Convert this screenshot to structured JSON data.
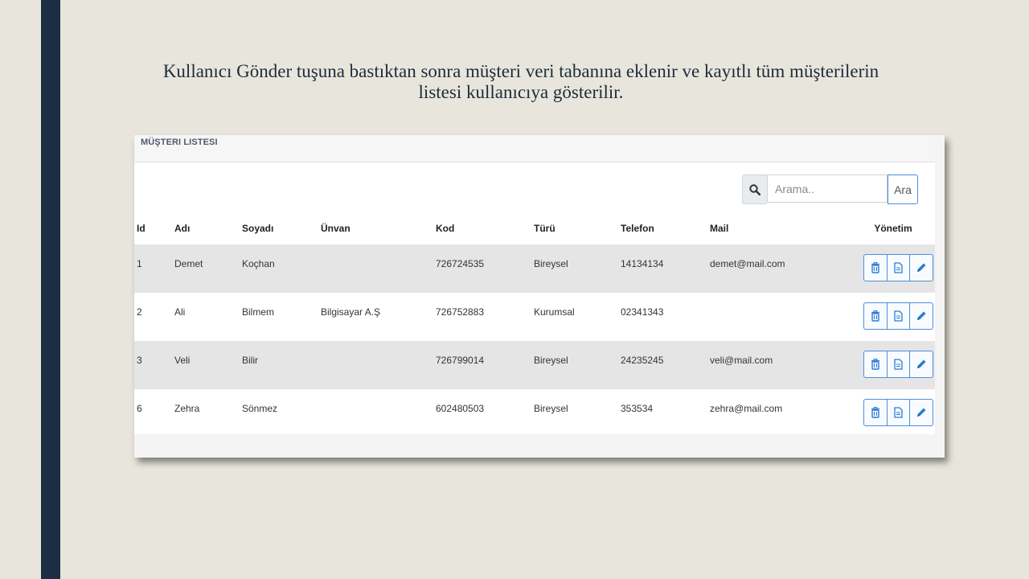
{
  "slide": {
    "caption_line1": "Kullanıcı Gönder tuşuna bastıktan sonra müşteri veri tabanına eklenir ve kayıtlı tüm müşterilerin",
    "caption_line2": "listesi kullanıcıya gösterilir."
  },
  "panel": {
    "title": "MÜŞTERI LISTESI"
  },
  "search": {
    "placeholder": "Arama..",
    "value": "",
    "button_label": "Ara",
    "icon": "search-icon"
  },
  "table": {
    "headers": [
      "Id",
      "Adı",
      "Soyadı",
      "Ünvan",
      "Kod",
      "Türü",
      "Telefon",
      "Mail",
      "Yönetim"
    ],
    "rows": [
      {
        "id": "1",
        "ad": "Demet",
        "soyad": "Koçhan",
        "unvan": "",
        "kod": "726724535",
        "turu": "Bireysel",
        "telefon": "14134134",
        "mail": "demet@mail.com"
      },
      {
        "id": "2",
        "ad": "Ali",
        "soyad": "Bilmem",
        "unvan": "Bilgisayar A.Ş",
        "kod": "726752883",
        "turu": "Kurumsal",
        "telefon": "02341343",
        "mail": ""
      },
      {
        "id": "3",
        "ad": "Veli",
        "soyad": "Bilir",
        "unvan": "",
        "kod": "726799014",
        "turu": "Bireysel",
        "telefon": "24235245",
        "mail": "veli@mail.com"
      },
      {
        "id": "6",
        "ad": "Zehra",
        "soyad": "Sönmez",
        "unvan": "",
        "kod": "602480503",
        "turu": "Bireysel",
        "telefon": "353534",
        "mail": "zehra@mail.com"
      }
    ],
    "row_actions": [
      "trash-icon",
      "document-icon",
      "pencil-icon"
    ]
  },
  "colors": {
    "background": "#e8e6dc",
    "sidebar": "#1b2e43",
    "accent": "#4a90d9",
    "stripe": "#e5e5e5"
  }
}
